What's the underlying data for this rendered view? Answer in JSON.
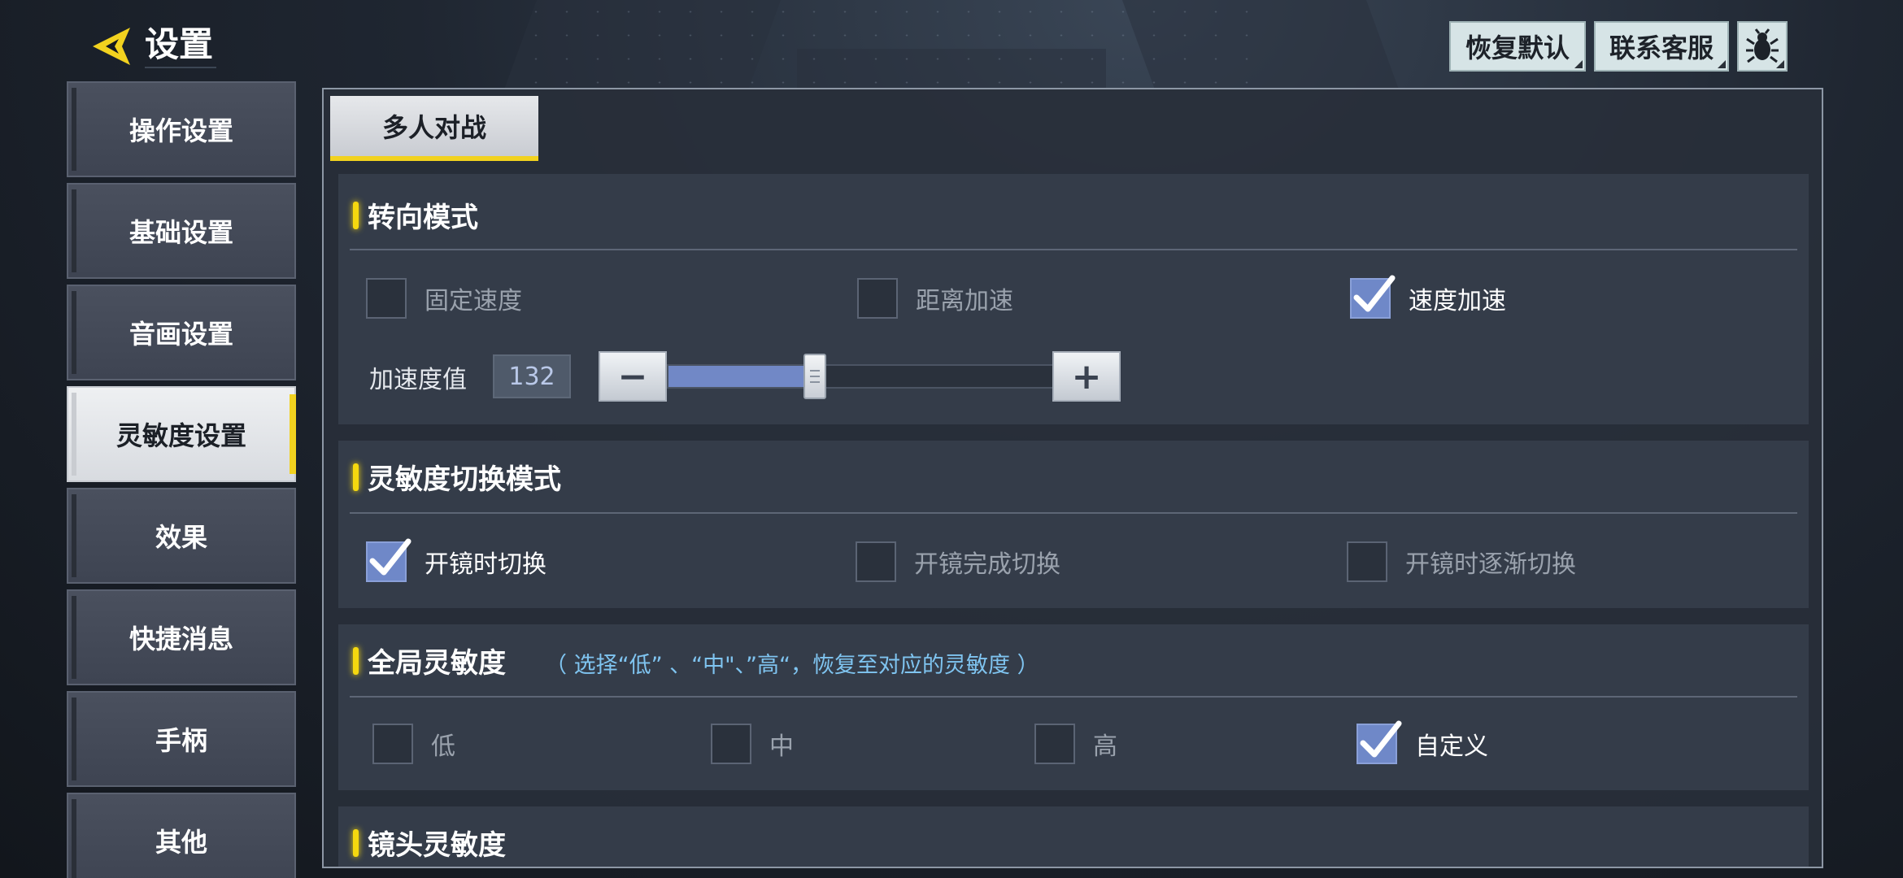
{
  "header": {
    "title": "设置",
    "reset_label": "恢复默认",
    "support_label": "联系客服",
    "bug_icon": "bug-icon"
  },
  "sidebar": {
    "items": [
      {
        "label": "操作设置"
      },
      {
        "label": "基础设置"
      },
      {
        "label": "音画设置"
      },
      {
        "label": "灵敏度设置",
        "active": true
      },
      {
        "label": "效果"
      },
      {
        "label": "快捷消息"
      },
      {
        "label": "手柄"
      },
      {
        "label": "其他"
      }
    ]
  },
  "tabs": [
    {
      "label": "多人对战",
      "active": true
    }
  ],
  "turn_mode": {
    "title": "转向模式",
    "options": [
      {
        "label": "固定速度",
        "checked": false
      },
      {
        "label": "距离加速",
        "checked": false
      },
      {
        "label": "速度加速",
        "checked": true
      }
    ],
    "accel_label": "加速度值",
    "accel_value": "132",
    "accel_fraction": 0.38,
    "minus_label": "−",
    "plus_label": "+"
  },
  "switch_mode": {
    "title": "灵敏度切换模式",
    "options": [
      {
        "label": "开镜时切换",
        "checked": true
      },
      {
        "label": "开镜完成切换",
        "checked": false
      },
      {
        "label": "开镜时逐渐切换",
        "checked": false
      }
    ]
  },
  "global_sens": {
    "title": "全局灵敏度",
    "note": "（ 选择“低” 、“中\"、”高“，恢复至对应的灵敏度 ）",
    "options": [
      {
        "label": "低",
        "checked": false
      },
      {
        "label": "中",
        "checked": false
      },
      {
        "label": "高",
        "checked": false
      },
      {
        "label": "自定义",
        "checked": true
      }
    ]
  },
  "camera_sens": {
    "title": "镜头灵敏度"
  },
  "colors": {
    "accent_yellow": "#f2d21f",
    "check_blue": "#6f88c8",
    "note_blue": "#7fc4f0"
  }
}
